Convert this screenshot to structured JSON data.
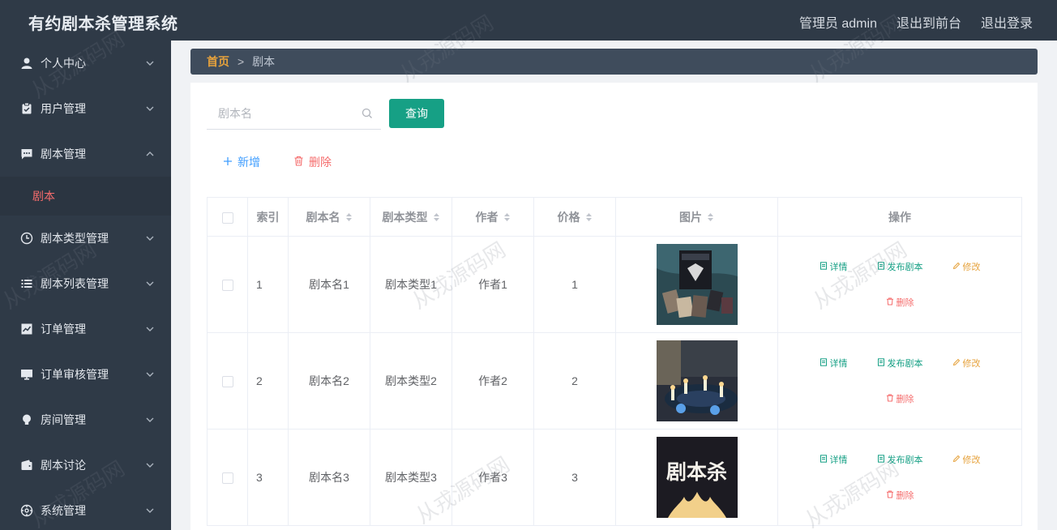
{
  "header": {
    "title": "有约剧本杀管理系统",
    "admin_label": "管理员 admin",
    "front_link": "退出到前台",
    "logout_link": "退出登录"
  },
  "sidebar": {
    "items": [
      {
        "label": "个人中心",
        "icon": "person-icon"
      },
      {
        "label": "用户管理",
        "icon": "clipboard-icon"
      },
      {
        "label": "剧本管理",
        "icon": "chat-icon",
        "expanded": true
      },
      {
        "label": "剧本类型管理",
        "icon": "clock-icon"
      },
      {
        "label": "剧本列表管理",
        "icon": "list-icon"
      },
      {
        "label": "订单管理",
        "icon": "chart-icon"
      },
      {
        "label": "订单审核管理",
        "icon": "monitor-icon"
      },
      {
        "label": "房间管理",
        "icon": "bulb-icon"
      },
      {
        "label": "剧本讨论",
        "icon": "wallet-icon"
      },
      {
        "label": "系统管理",
        "icon": "gear-icon"
      }
    ],
    "sub_item": "剧本"
  },
  "breadcrumb": {
    "home": "首页",
    "separator": ">",
    "current": "剧本"
  },
  "search": {
    "placeholder": "剧本名",
    "query_button": "查询"
  },
  "toolbar": {
    "add_label": "新增",
    "delete_label": "删除"
  },
  "table": {
    "headers": [
      "索引",
      "剧本名",
      "剧本类型",
      "作者",
      "价格",
      "图片",
      "操作"
    ],
    "rows": [
      {
        "index": "1",
        "name": "剧本名1",
        "type": "剧本类型1",
        "author": "作者1",
        "price": "1",
        "image": "game-box-photo"
      },
      {
        "index": "2",
        "name": "剧本名2",
        "type": "剧本类型2",
        "author": "作者2",
        "price": "2",
        "image": "candle-table-photo"
      },
      {
        "index": "3",
        "name": "剧本名3",
        "type": "剧本类型3",
        "author": "作者3",
        "price": "3",
        "image": "script-kill-poster",
        "image_text": "剧本杀"
      }
    ],
    "actions": {
      "detail": "详情",
      "publish": "发布剧本",
      "edit": "修改",
      "delete": "删除"
    }
  },
  "watermark": "从戎源码网",
  "colors": {
    "header_bg": "#2f3a47",
    "accent_green": "#16a085",
    "active_red": "#f56c6c",
    "edit_orange": "#e6a23c",
    "add_blue": "#409eff"
  }
}
